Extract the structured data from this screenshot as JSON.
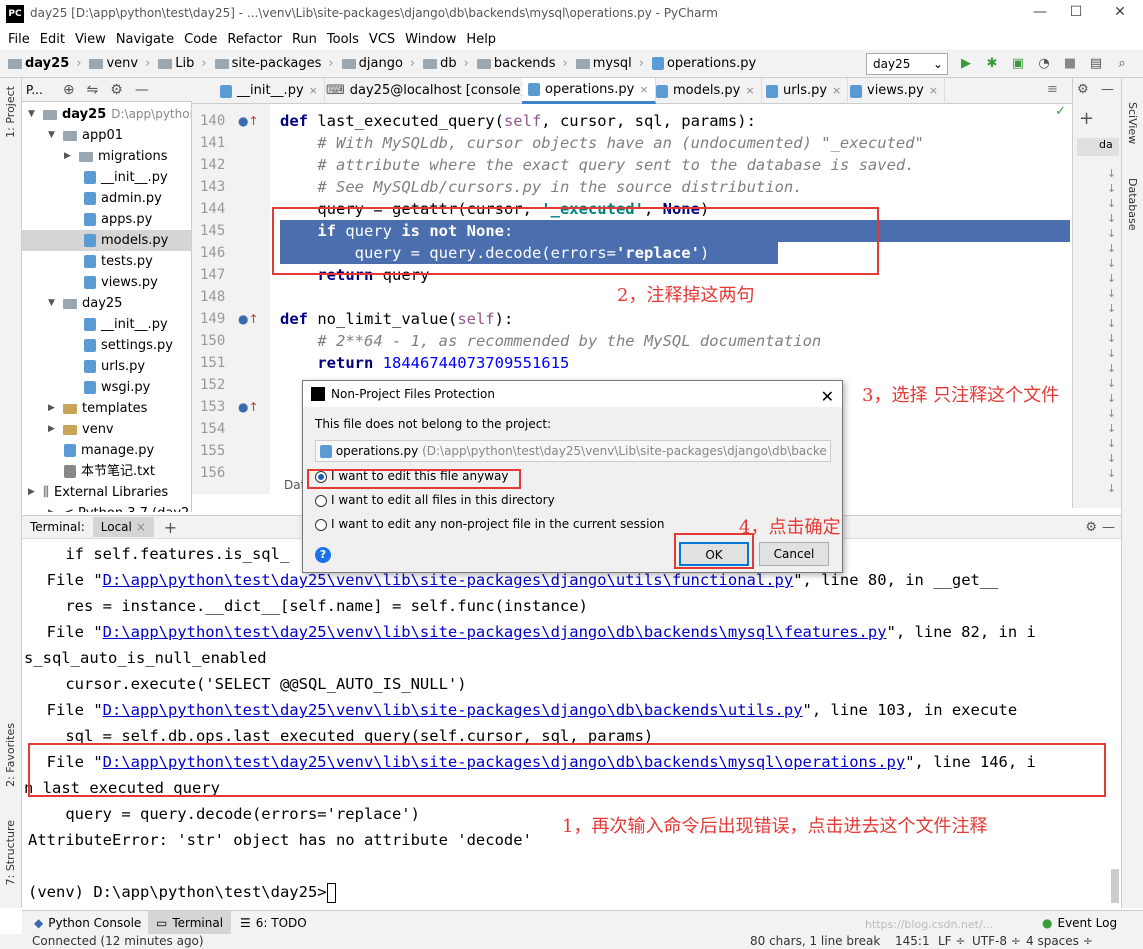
{
  "window": {
    "title": "day25 [D:\\app\\python\\test\\day25] - ...\\venv\\Lib\\site-packages\\django\\db\\backends\\mysql\\operations.py - PyCharm",
    "logo": "PC"
  },
  "menu": [
    "File",
    "Edit",
    "View",
    "Navigate",
    "Code",
    "Refactor",
    "Run",
    "Tools",
    "VCS",
    "Window",
    "Help"
  ],
  "breadcrumb": [
    "day25",
    "venv",
    "Lib",
    "site-packages",
    "django",
    "db",
    "backends",
    "mysql",
    "operations.py"
  ],
  "run_config": "day25",
  "project": {
    "header": "P...",
    "items": [
      {
        "label": "day25",
        "note": "D:\\app\\python",
        "level": 0,
        "type": "folder",
        "expanded": true
      },
      {
        "label": "app01",
        "level": 1,
        "type": "folder",
        "expanded": true
      },
      {
        "label": "migrations",
        "level": 2,
        "type": "folder",
        "expanded": false
      },
      {
        "label": "__init__.py",
        "level": 2,
        "type": "py"
      },
      {
        "label": "admin.py",
        "level": 2,
        "type": "py"
      },
      {
        "label": "apps.py",
        "level": 2,
        "type": "py"
      },
      {
        "label": "models.py",
        "level": 2,
        "type": "py",
        "selected": true
      },
      {
        "label": "tests.py",
        "level": 2,
        "type": "py"
      },
      {
        "label": "views.py",
        "level": 2,
        "type": "py"
      },
      {
        "label": "day25",
        "level": 1,
        "type": "folder",
        "expanded": true
      },
      {
        "label": "__init__.py",
        "level": 2,
        "type": "py"
      },
      {
        "label": "settings.py",
        "level": 2,
        "type": "py"
      },
      {
        "label": "urls.py",
        "level": 2,
        "type": "py"
      },
      {
        "label": "wsgi.py",
        "level": 2,
        "type": "py"
      },
      {
        "label": "templates",
        "level": 1,
        "type": "folder",
        "expanded": false
      },
      {
        "label": "venv",
        "level": 1,
        "type": "folder",
        "expanded": false
      },
      {
        "label": "manage.py",
        "level": 1,
        "type": "py"
      },
      {
        "label": "本节笔记.txt",
        "level": 1,
        "type": "txt"
      },
      {
        "label": "External Libraries",
        "level": 0,
        "type": "lib",
        "expanded": false
      },
      {
        "label": "< Python 3.7 (day2...",
        "level": 1,
        "type": "lib"
      }
    ]
  },
  "editor_tabs": [
    {
      "label": "__init__.py"
    },
    {
      "label": "day25@localhost [console]"
    },
    {
      "label": "operations.py",
      "active": true
    },
    {
      "label": "models.py"
    },
    {
      "label": "urls.py"
    },
    {
      "label": "views.py"
    }
  ],
  "code_lines": [
    {
      "n": "140"
    },
    {
      "n": "141"
    },
    {
      "n": "142"
    },
    {
      "n": "143"
    },
    {
      "n": "144"
    },
    {
      "n": "145"
    },
    {
      "n": "146"
    },
    {
      "n": "147"
    },
    {
      "n": "148"
    },
    {
      "n": "149"
    },
    {
      "n": "150"
    },
    {
      "n": "151"
    },
    {
      "n": "152"
    },
    {
      "n": "153"
    },
    {
      "n": "154"
    },
    {
      "n": "155"
    },
    {
      "n": "156"
    }
  ],
  "code": {
    "l140_def": "def ",
    "l140_name": "last_executed_query(",
    "l140_self": "self",
    "l140_rest": ", cursor, sql, params):",
    "l141": "    # With MySQLdb, cursor objects have an (undocumented) \"_executed\"",
    "l142": "    # attribute where the exact query sent to the database is saved.",
    "l143": "    # See MySQLdb/cursors.py in the source distribution.",
    "l144_a": "    query = getattr(cursor, ",
    "l144_s": "'_executed'",
    "l144_b": ", ",
    "l144_c": "None",
    "l144_d": ")",
    "l145_kw": "    if ",
    "l145_a": "query ",
    "l145_kw2": "is not ",
    "l145_n": "None",
    "l145_b": ":",
    "l146_a": "        query = query.decode(errors=",
    "l146_s": "'replace'",
    "l146_b": ")",
    "l147_kw": "    return ",
    "l147_a": "query",
    "l149_def": "def ",
    "l149_name": "no_limit_value(",
    "l149_self": "self",
    "l149_rest": "):",
    "l150": "    # 2**64 - 1, as recommended by the MySQL documentation",
    "l151_kw": "    return ",
    "l151_n": "18446744073709551615"
  },
  "editor_footer": "Dat",
  "terminal": {
    "label": "Terminal:",
    "tab": "Local",
    "lines": [
      {
        "pre": "    if self.features.is_sql_"
      },
      {
        "pre": "  File \"",
        "link": "D:\\app\\python\\test\\day25\\venv\\lib\\site-packages\\django\\utils\\functional.py",
        "post": "\", line 80, in __get__"
      },
      {
        "pre": "    res = instance.__dict__[self.name] = self.func(instance)"
      },
      {
        "pre": "  File \"",
        "link": "D:\\app\\python\\test\\day25\\venv\\lib\\site-packages\\django\\db\\backends\\mysql\\features.py",
        "post": "\", line 82, in i"
      },
      {
        "pre": "s_sql_auto_is_null_enabled"
      },
      {
        "pre": "    cursor.execute('SELECT @@SQL_AUTO_IS_NULL')"
      },
      {
        "pre": "  File \"",
        "link": "D:\\app\\python\\test\\day25\\venv\\lib\\site-packages\\django\\db\\backends\\utils.py",
        "post": "\", line 103, in execute"
      },
      {
        "pre": "    sql = self.db.ops.last_executed_query(self.cursor, sql, params)"
      },
      {
        "pre": "  File \"",
        "link": "D:\\app\\python\\test\\day25\\venv\\lib\\site-packages\\django\\db\\backends\\mysql\\operations.py",
        "post": "\", line 146, i"
      },
      {
        "pre": "n last_executed_query"
      },
      {
        "pre": "    query = query.decode(errors='replace')"
      },
      {
        "pre": "AttributeError: 'str' object has no attribute 'decode'"
      },
      {
        "pre": ""
      },
      {
        "pre": "(venv) D:\\app\\python\\test\\day25>"
      }
    ]
  },
  "dialog": {
    "title": "Non-Project Files Protection",
    "message": "This file does not belong to the project:",
    "file_name": "operations.py",
    "file_path": "(D:\\app\\python\\test\\day25\\venv\\Lib\\site-packages\\django\\db\\backe",
    "options": [
      {
        "label": "I want to edit this file anyway",
        "selected": true
      },
      {
        "label": "I want to edit all files in this directory",
        "selected": false
      },
      {
        "label": "I want to edit any non-project file in the current session",
        "selected": false
      }
    ],
    "ok": "OK",
    "cancel": "Cancel"
  },
  "annotations": {
    "a1": "1，再次输入命令后出现错误，点击进去这个文件注释",
    "a2": "2，注释掉这两句",
    "a3": "3，选择 只注释这个文件",
    "a4": "4，点击确定"
  },
  "side_strips": {
    "left_top": "1: Project",
    "left_mid": "2: Favorites",
    "left_bot": "7: Structure",
    "right_top": "SciView",
    "right_bot": "Database"
  },
  "bottom_tabs": [
    "Python Console",
    "Terminal",
    "6: TODO"
  ],
  "event_log": "Event Log",
  "status": {
    "left": "Connected (12 minutes ago)",
    "chars": "80 chars, 1 line break",
    "pos": "145:1",
    "lf": "LF ÷",
    "enc": "UTF-8 ÷",
    "indent": "4 spaces ÷",
    "watermark": "https://blog.csdn.net/..."
  },
  "colors": {
    "accent": "#4083c9",
    "annotation": "#e53935",
    "selection": "#4b6eaf"
  }
}
